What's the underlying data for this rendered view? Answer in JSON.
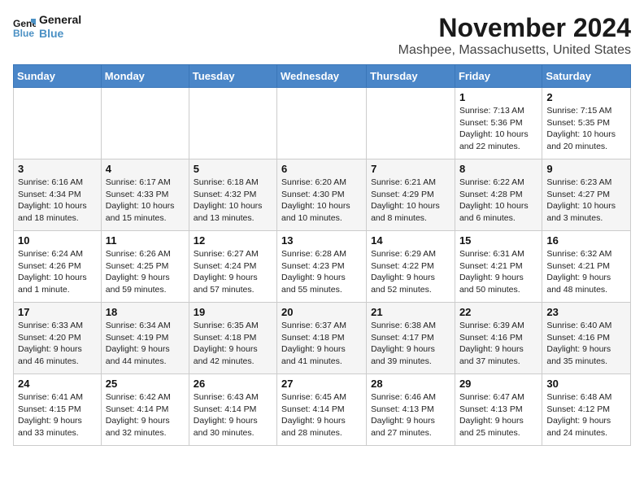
{
  "header": {
    "logo_line1": "General",
    "logo_line2": "Blue",
    "month_title": "November 2024",
    "location": "Mashpee, Massachusetts, United States"
  },
  "weekdays": [
    "Sunday",
    "Monday",
    "Tuesday",
    "Wednesday",
    "Thursday",
    "Friday",
    "Saturday"
  ],
  "weeks": [
    [
      {
        "day": "",
        "info": ""
      },
      {
        "day": "",
        "info": ""
      },
      {
        "day": "",
        "info": ""
      },
      {
        "day": "",
        "info": ""
      },
      {
        "day": "",
        "info": ""
      },
      {
        "day": "1",
        "info": "Sunrise: 7:13 AM\nSunset: 5:36 PM\nDaylight: 10 hours and 22 minutes."
      },
      {
        "day": "2",
        "info": "Sunrise: 7:15 AM\nSunset: 5:35 PM\nDaylight: 10 hours and 20 minutes."
      }
    ],
    [
      {
        "day": "3",
        "info": "Sunrise: 6:16 AM\nSunset: 4:34 PM\nDaylight: 10 hours and 18 minutes."
      },
      {
        "day": "4",
        "info": "Sunrise: 6:17 AM\nSunset: 4:33 PM\nDaylight: 10 hours and 15 minutes."
      },
      {
        "day": "5",
        "info": "Sunrise: 6:18 AM\nSunset: 4:32 PM\nDaylight: 10 hours and 13 minutes."
      },
      {
        "day": "6",
        "info": "Sunrise: 6:20 AM\nSunset: 4:30 PM\nDaylight: 10 hours and 10 minutes."
      },
      {
        "day": "7",
        "info": "Sunrise: 6:21 AM\nSunset: 4:29 PM\nDaylight: 10 hours and 8 minutes."
      },
      {
        "day": "8",
        "info": "Sunrise: 6:22 AM\nSunset: 4:28 PM\nDaylight: 10 hours and 6 minutes."
      },
      {
        "day": "9",
        "info": "Sunrise: 6:23 AM\nSunset: 4:27 PM\nDaylight: 10 hours and 3 minutes."
      }
    ],
    [
      {
        "day": "10",
        "info": "Sunrise: 6:24 AM\nSunset: 4:26 PM\nDaylight: 10 hours and 1 minute."
      },
      {
        "day": "11",
        "info": "Sunrise: 6:26 AM\nSunset: 4:25 PM\nDaylight: 9 hours and 59 minutes."
      },
      {
        "day": "12",
        "info": "Sunrise: 6:27 AM\nSunset: 4:24 PM\nDaylight: 9 hours and 57 minutes."
      },
      {
        "day": "13",
        "info": "Sunrise: 6:28 AM\nSunset: 4:23 PM\nDaylight: 9 hours and 55 minutes."
      },
      {
        "day": "14",
        "info": "Sunrise: 6:29 AM\nSunset: 4:22 PM\nDaylight: 9 hours and 52 minutes."
      },
      {
        "day": "15",
        "info": "Sunrise: 6:31 AM\nSunset: 4:21 PM\nDaylight: 9 hours and 50 minutes."
      },
      {
        "day": "16",
        "info": "Sunrise: 6:32 AM\nSunset: 4:21 PM\nDaylight: 9 hours and 48 minutes."
      }
    ],
    [
      {
        "day": "17",
        "info": "Sunrise: 6:33 AM\nSunset: 4:20 PM\nDaylight: 9 hours and 46 minutes."
      },
      {
        "day": "18",
        "info": "Sunrise: 6:34 AM\nSunset: 4:19 PM\nDaylight: 9 hours and 44 minutes."
      },
      {
        "day": "19",
        "info": "Sunrise: 6:35 AM\nSunset: 4:18 PM\nDaylight: 9 hours and 42 minutes."
      },
      {
        "day": "20",
        "info": "Sunrise: 6:37 AM\nSunset: 4:18 PM\nDaylight: 9 hours and 41 minutes."
      },
      {
        "day": "21",
        "info": "Sunrise: 6:38 AM\nSunset: 4:17 PM\nDaylight: 9 hours and 39 minutes."
      },
      {
        "day": "22",
        "info": "Sunrise: 6:39 AM\nSunset: 4:16 PM\nDaylight: 9 hours and 37 minutes."
      },
      {
        "day": "23",
        "info": "Sunrise: 6:40 AM\nSunset: 4:16 PM\nDaylight: 9 hours and 35 minutes."
      }
    ],
    [
      {
        "day": "24",
        "info": "Sunrise: 6:41 AM\nSunset: 4:15 PM\nDaylight: 9 hours and 33 minutes."
      },
      {
        "day": "25",
        "info": "Sunrise: 6:42 AM\nSunset: 4:14 PM\nDaylight: 9 hours and 32 minutes."
      },
      {
        "day": "26",
        "info": "Sunrise: 6:43 AM\nSunset: 4:14 PM\nDaylight: 9 hours and 30 minutes."
      },
      {
        "day": "27",
        "info": "Sunrise: 6:45 AM\nSunset: 4:14 PM\nDaylight: 9 hours and 28 minutes."
      },
      {
        "day": "28",
        "info": "Sunrise: 6:46 AM\nSunset: 4:13 PM\nDaylight: 9 hours and 27 minutes."
      },
      {
        "day": "29",
        "info": "Sunrise: 6:47 AM\nSunset: 4:13 PM\nDaylight: 9 hours and 25 minutes."
      },
      {
        "day": "30",
        "info": "Sunrise: 6:48 AM\nSunset: 4:12 PM\nDaylight: 9 hours and 24 minutes."
      }
    ]
  ]
}
